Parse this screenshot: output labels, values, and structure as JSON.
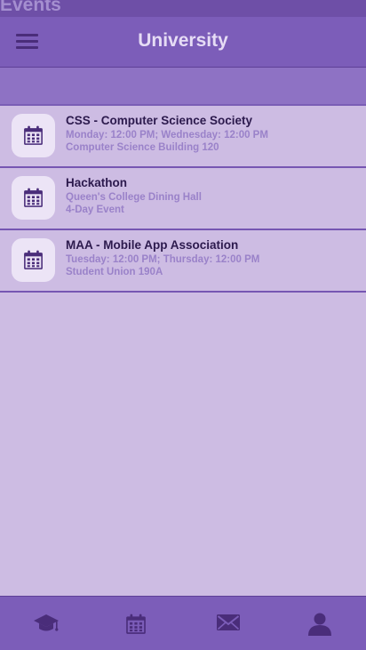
{
  "page": {
    "label": "Events"
  },
  "header": {
    "title": "University",
    "menu_icon": "hamburger-menu-icon"
  },
  "events": [
    {
      "name": "CSS - Computer Science Society",
      "line1": "Monday: 12:00 PM; Wednesday: 12:00 PM",
      "line2": "Computer Science Building 120",
      "icon": "calendar-icon"
    },
    {
      "name": "Hackathon",
      "line1": "Queen's College Dining Hall",
      "line2": "4-Day Event",
      "icon": "calendar-icon"
    },
    {
      "name": "MAA - Mobile App Association",
      "line1": "Tuesday: 12:00 PM; Thursday: 12:00 PM",
      "line2": "Student Union 190A",
      "icon": "calendar-icon"
    }
  ],
  "bottom_nav": [
    {
      "icon": "graduation-cap-icon"
    },
    {
      "icon": "calendar-icon"
    },
    {
      "icon": "envelope-icon"
    },
    {
      "icon": "user-icon"
    }
  ],
  "colors": {
    "header_bg": "#7c5db9",
    "page_bg": "#cdbce3",
    "icon_dark": "#4a2d7a",
    "event_title": "#2c1a4d",
    "event_detail": "#9a82c9"
  }
}
